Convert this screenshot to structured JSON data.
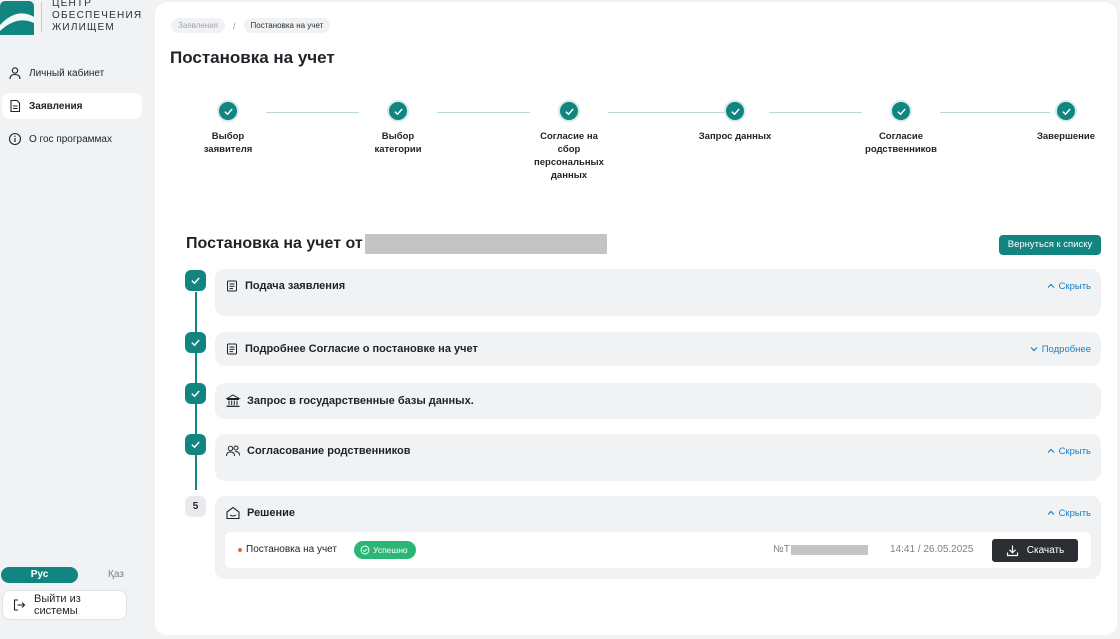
{
  "logo": {
    "line1": "ЦЕНТР",
    "line2": "ОБЕСПЕЧЕНИЯ",
    "line3": "ЖИЛИЩЕМ"
  },
  "sidebar": {
    "items": [
      {
        "label": "Личный кабинет",
        "icon": "user-icon",
        "active": false
      },
      {
        "label": "Заявления",
        "icon": "document-icon",
        "active": true
      },
      {
        "label": "О гос программах",
        "icon": "info-icon",
        "active": false
      }
    ],
    "lang_ru": "Рус",
    "lang_kz": "Қаз",
    "logout_label": "Выйти из системы"
  },
  "breadcrumb": {
    "items": [
      "Заявления",
      "Постановка на учет"
    ],
    "separator": "/"
  },
  "page_title": "Постановка на учет",
  "stepper": {
    "steps": [
      {
        "label": "Выбор\nзаявителя",
        "status": "done"
      },
      {
        "label": "Выбор\nкатегории",
        "status": "done"
      },
      {
        "label": "Согласие на\nсбор\nперсональных\nданных",
        "status": "done"
      },
      {
        "label": "Запрос данных",
        "status": "done"
      },
      {
        "label": "Согласие\nродственников",
        "status": "done"
      },
      {
        "label": "Завершение",
        "status": "done"
      }
    ]
  },
  "application": {
    "title_prefix": "Постановка на учет от",
    "back_button": "Вернуться к списку"
  },
  "timeline": [
    {
      "marker": "check",
      "title": "Подача заявления",
      "icon": "document-icon",
      "toggle": "Скрыть",
      "toggle_icon": "chevron-up-icon"
    },
    {
      "marker": "check",
      "title": "Подробнее Согласие о постановке на учет",
      "icon": "document-icon",
      "toggle": "Подробнее",
      "toggle_icon": "chevron-down-icon"
    },
    {
      "marker": "check",
      "title": "Запрос в государственные базы данных.",
      "icon": "government-building-icon",
      "toggle": "",
      "toggle_icon": ""
    },
    {
      "marker": "check",
      "title": "Согласование родственников",
      "icon": "people-icon",
      "toggle": "Скрыть",
      "toggle_icon": "chevron-up-icon"
    },
    {
      "marker": "5",
      "title": "Решение",
      "icon": "home-icon",
      "toggle": "Скрыть",
      "toggle_icon": "chevron-up-icon"
    }
  ],
  "decision": {
    "name": "Постановка на учет",
    "status": "Успешно",
    "number_prefix": "№Т",
    "datetime": "14:41 / 26.05.2025",
    "download_label": "Скачать"
  },
  "colors": {
    "accent": "#128581",
    "success": "#2bb673",
    "link": "#1a7fc4",
    "dark_button": "#2b2f33",
    "bullet": "#e8692a"
  }
}
